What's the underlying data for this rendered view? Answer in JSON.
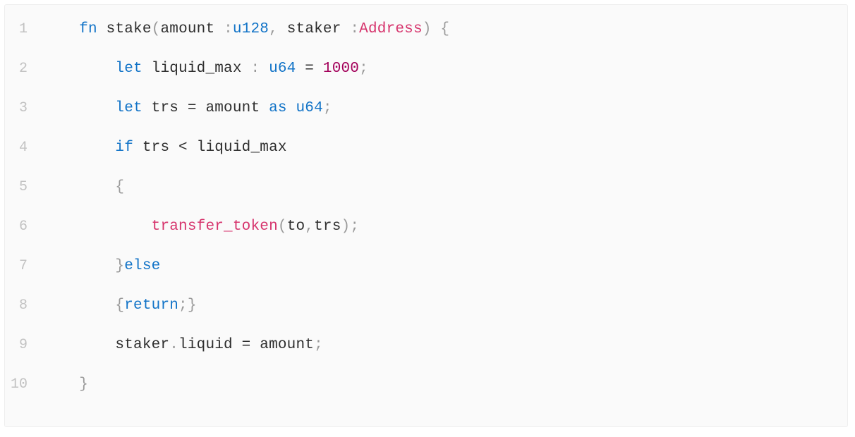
{
  "lines": {
    "n1": "1",
    "n2": "2",
    "n3": "3",
    "n4": "4",
    "n5": "5",
    "n6": "6",
    "n7": "7",
    "n8": "8",
    "n9": "9",
    "n10": "10"
  },
  "t": {
    "fn": "fn",
    "stake": "stake",
    "op": "(",
    "amount": "amount",
    "colon1": " :",
    "u128": "u128",
    "comma": ", ",
    "staker": "staker",
    "colon2": " :",
    "Address": "Address",
    "cp": ")",
    "sp": " ",
    "ob": "{",
    "indent1": "    ",
    "indent2": "        ",
    "let": "let",
    "liquid_max": "liquid_max",
    "colontype": " : ",
    "u64": "u64",
    "eq": " = ",
    "thousand": "1000",
    "semi": ";",
    "trs": "trs",
    "eq2": " = ",
    "as": "as",
    "sp2": " ",
    "if": "if",
    "lt": " < ",
    "transfer": "transfer_token",
    "to": "to",
    "comma2": ",",
    "cb": "}",
    "else": "else",
    "return": "return",
    "dot": ".",
    "liquid": "liquid",
    "eq3": " = "
  }
}
